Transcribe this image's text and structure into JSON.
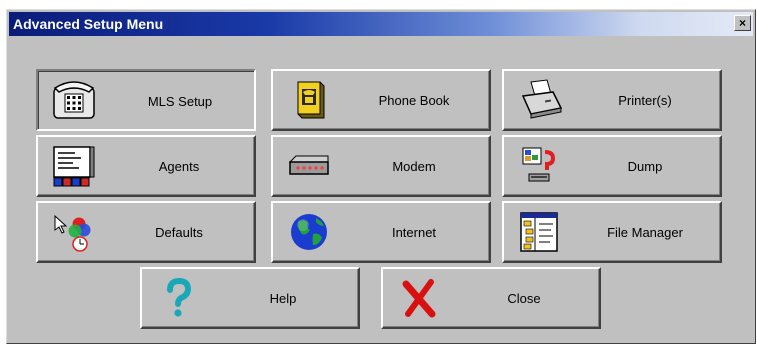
{
  "window": {
    "title": "Advanced Setup Menu",
    "close_glyph": "×"
  },
  "buttons": [
    {
      "id": "mls-setup",
      "label": "MLS Setup",
      "icon": "telephone-icon",
      "pressed": true
    },
    {
      "id": "phone-book",
      "label": "Phone Book",
      "icon": "phone-book-icon",
      "pressed": false
    },
    {
      "id": "printers",
      "label": "Printer(s)",
      "icon": "printer-icon",
      "pressed": false
    },
    {
      "id": "agents",
      "label": "Agents",
      "icon": "agents-list-icon",
      "pressed": false
    },
    {
      "id": "modem",
      "label": "Modem",
      "icon": "modem-icon",
      "pressed": false
    },
    {
      "id": "dump",
      "label": "Dump",
      "icon": "dump-icon",
      "pressed": false
    },
    {
      "id": "defaults",
      "label": "Defaults",
      "icon": "defaults-icon",
      "pressed": false
    },
    {
      "id": "internet",
      "label": "Internet",
      "icon": "globe-icon",
      "pressed": false
    },
    {
      "id": "file-manager",
      "label": "File Manager",
      "icon": "file-manager-icon",
      "pressed": false
    },
    {
      "id": "help",
      "label": "Help",
      "icon": "question-mark-icon",
      "pressed": false
    },
    {
      "id": "close",
      "label": "Close",
      "icon": "red-x-icon",
      "pressed": false
    }
  ],
  "colors": {
    "face": "#c0c0c0",
    "title_start": "#0a1c7a",
    "title_end": "#e4e9f6"
  }
}
